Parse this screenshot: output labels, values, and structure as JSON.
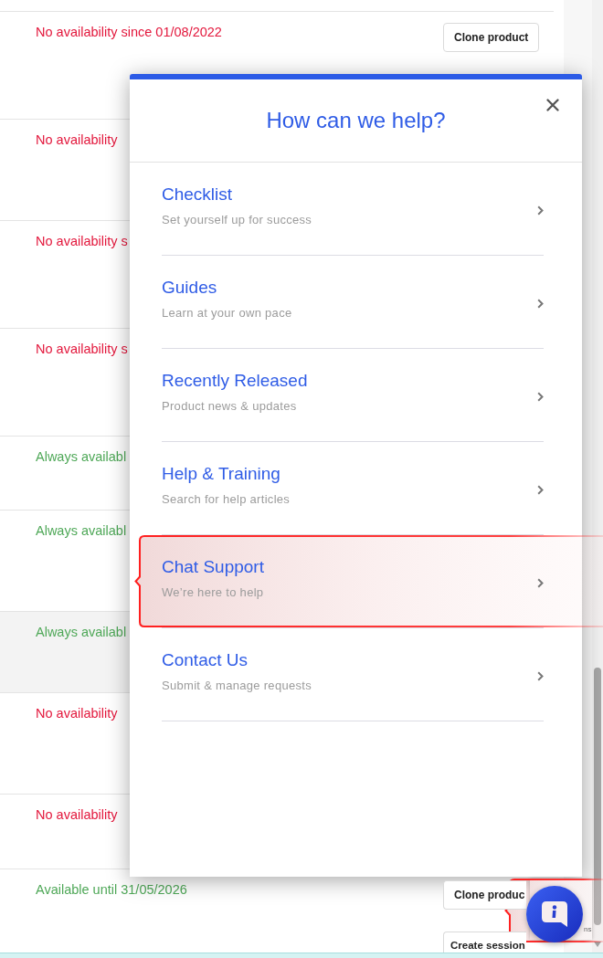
{
  "rows": [
    {
      "color": "#e3173c",
      "availability": "No availability since 01/08/2022",
      "hovered": false,
      "buttons": [
        "Clone product"
      ]
    },
    {
      "color": "#e3173c",
      "availability": "No availability",
      "hovered": false
    },
    {
      "color": "#e3173c",
      "availability": "No availability s",
      "hovered": false
    },
    {
      "color": "#e3173c",
      "availability": "No availability s",
      "hovered": false
    },
    {
      "color": "#4fa858",
      "availability": "Always availabl",
      "hovered": false
    },
    {
      "color": "#4fa858",
      "availability": "Always availabl",
      "hovered": false
    },
    {
      "color": "#4fa858",
      "availability": "Always availabl",
      "hovered": true
    },
    {
      "color": "#e3173c",
      "availability": "No availability",
      "hovered": false
    },
    {
      "color": "#e3173c",
      "availability": "No availability",
      "hovered": false
    },
    {
      "color": "#4fa858",
      "availability": "Available until 31/05/2026",
      "hovered": false,
      "buttons": [
        "Clone produc",
        "Create session"
      ]
    }
  ],
  "help_panel": {
    "title": "How can we help?",
    "items": [
      {
        "title": "Checklist",
        "subtitle": "Set yourself up for success",
        "highlighted": false
      },
      {
        "title": "Guides",
        "subtitle": "Learn at your own pace",
        "highlighted": false
      },
      {
        "title": "Recently Released",
        "subtitle": "Product news & updates",
        "highlighted": false
      },
      {
        "title": "Help & Training",
        "subtitle": "Search for help articles",
        "highlighted": false
      },
      {
        "title": "Chat Support",
        "subtitle": "We’re here to help",
        "highlighted": true
      },
      {
        "title": "Contact Us",
        "subtitle": "Submit & manage requests",
        "highlighted": false
      }
    ]
  },
  "badge": {
    "text": "ns"
  },
  "launcher": {
    "highlighted": true
  }
}
